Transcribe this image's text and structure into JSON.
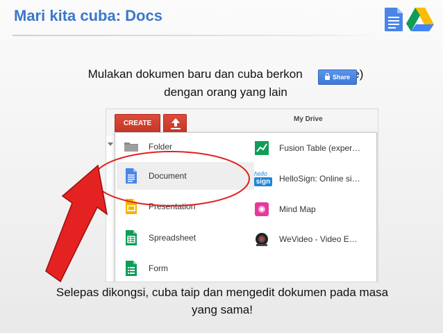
{
  "slide": {
    "title": "Mari kita cuba: Docs",
    "instruction_line1": "Mulakan dokumen baru dan cuba berkon",
    "instruction_line1_tail": "hare)",
    "instruction_line2": "dengan orang yang lain",
    "caption_line1": "Selepas dikongsi, cuba taip dan mengedit dokumen pada masa",
    "caption_line2": "yang sama!"
  },
  "logos": [
    "google-docs-logo",
    "google-drive-logo"
  ],
  "share_button": {
    "label": "Share",
    "icon": "lock-icon"
  },
  "drive": {
    "create_label": "CREATE",
    "upload_icon": "upload-icon",
    "my_drive_label": "My Drive",
    "menu": {
      "left": [
        {
          "label": "Folder",
          "icon": "folder-icon"
        },
        {
          "label": "Document",
          "icon": "document-icon",
          "highlighted": true
        },
        {
          "label": "Presentation",
          "icon": "presentation-icon"
        },
        {
          "label": "Spreadsheet",
          "icon": "spreadsheet-icon"
        },
        {
          "label": "Form",
          "icon": "form-icon"
        }
      ],
      "right": [
        {
          "label": "Fusion Table (exper…",
          "icon": "fusion-table-icon"
        },
        {
          "label": "HelloSign: Online si…",
          "icon": "hellosign-icon",
          "icon_text_1": "hello",
          "icon_text_2": "sign"
        },
        {
          "label": "Mind Map",
          "icon": "mind-map-icon"
        },
        {
          "label": "WeVideo - Video E…",
          "icon": "wevideo-icon"
        }
      ]
    }
  },
  "colors": {
    "title_blue": "#3b78c9",
    "create_red": "#dd4b39",
    "share_blue": "#4d8ae5",
    "annotation_red": "#e02020"
  }
}
